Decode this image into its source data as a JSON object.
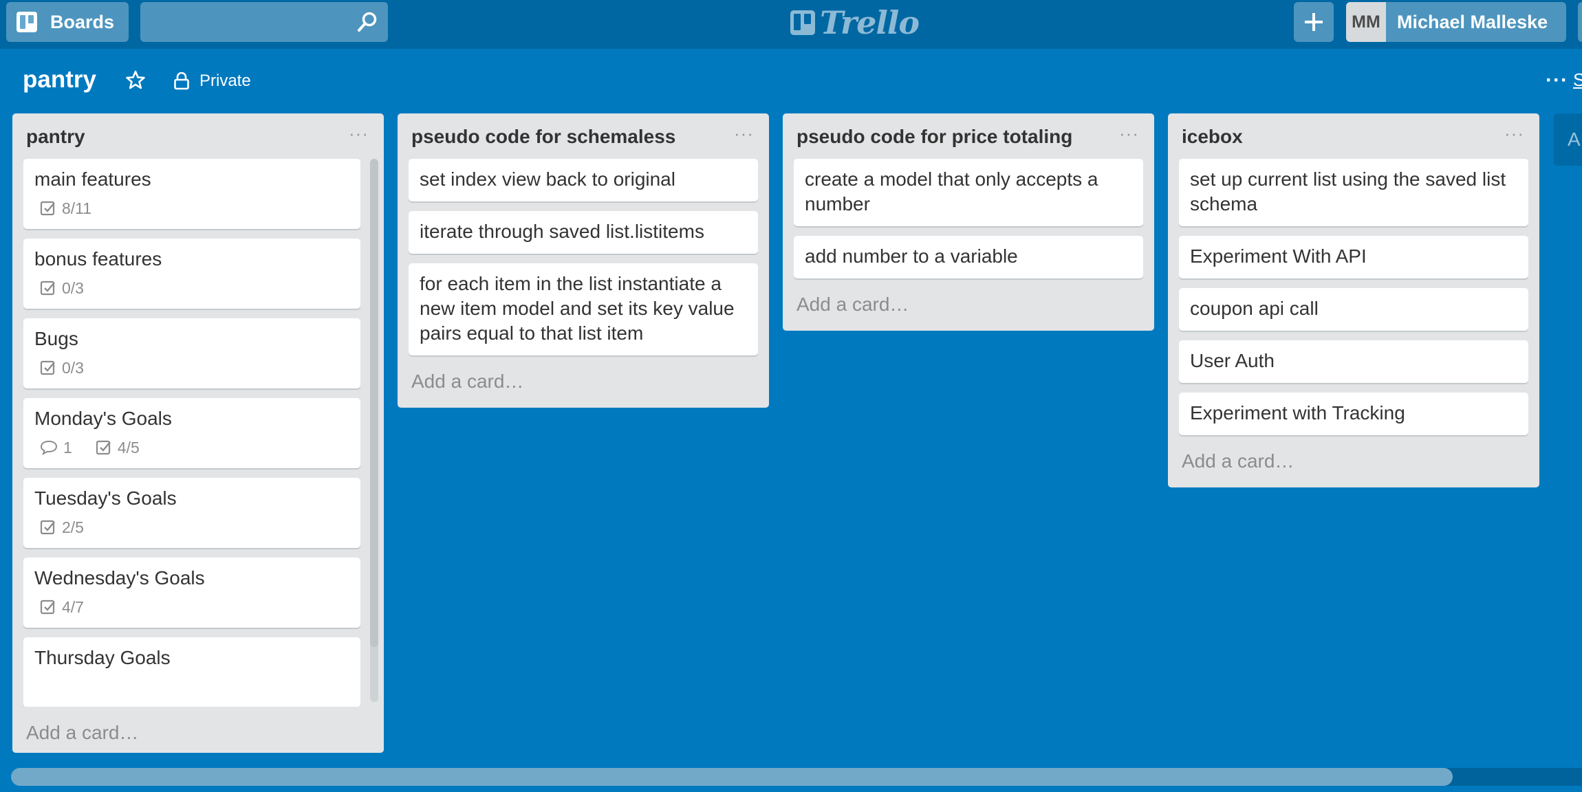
{
  "header": {
    "boards_label": "Boards",
    "search_placeholder": "",
    "logo_text": "Trello",
    "user_initials": "MM",
    "user_name": "Michael Malleske"
  },
  "board": {
    "title": "pantry",
    "visibility": "Private",
    "menu_more": "···",
    "menu_label": "S"
  },
  "lists": [
    {
      "title": "pantry",
      "cards": [
        {
          "title": "main features",
          "checklist": "8/11"
        },
        {
          "title": "bonus features",
          "checklist": "0/3"
        },
        {
          "title": "Bugs",
          "checklist": "0/3"
        },
        {
          "title": "Monday's Goals",
          "comments": "1",
          "checklist": "4/5"
        },
        {
          "title": "Tuesday's Goals",
          "checklist": "2/5"
        },
        {
          "title": "Wednesday's Goals",
          "checklist": "4/7"
        },
        {
          "title": "Thursday Goals"
        }
      ],
      "add_card": "Add a card…"
    },
    {
      "title": "pseudo code for schemaless",
      "cards": [
        {
          "title": "set index view back to original"
        },
        {
          "title": "iterate through saved list.listitems"
        },
        {
          "title": "for each item in the list instantiate a new item model and set its key value pairs equal to that list item"
        }
      ],
      "add_card": "Add a card…"
    },
    {
      "title": "pseudo code for price totaling",
      "cards": [
        {
          "title": "create a model that only accepts a number"
        },
        {
          "title": "add number to a variable"
        }
      ],
      "add_card": "Add a card…"
    },
    {
      "title": "icebox",
      "cards": [
        {
          "title": "set up current list using the saved list schema"
        },
        {
          "title": "Experiment With API"
        },
        {
          "title": "coupon api call"
        },
        {
          "title": "User Auth"
        },
        {
          "title": "Experiment with Tracking"
        }
      ],
      "add_card": "Add a card…"
    }
  ],
  "add_list_partial": "A",
  "list_menu_glyph": "···",
  "colors": {
    "board_bg": "#0079bf",
    "header_bg": "#0067a3",
    "list_bg": "#e2e4e6"
  }
}
